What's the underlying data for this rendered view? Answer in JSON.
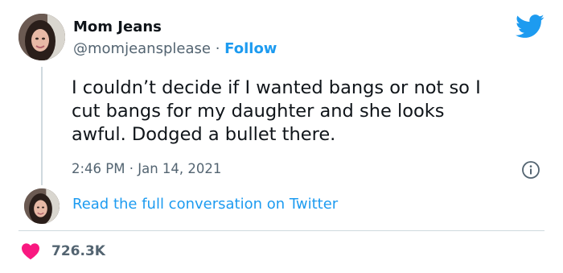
{
  "author": {
    "name": "Mom Jeans",
    "handle": "@momjeansplease",
    "separator": "·",
    "follow_label": "Follow"
  },
  "tweet": {
    "text": "I couldn’t decide if I wanted bangs or not so I\ncut bangs for my daughter and she looks\nawful. Dodged a bullet there.",
    "timestamp": "2:46 PM · Jan 14, 2021"
  },
  "conversation": {
    "link_label": "Read the full conversation on Twitter"
  },
  "engagement": {
    "likes": "726.3K"
  },
  "icons": {
    "brand": "twitter-bird-icon",
    "info": "info-icon",
    "like": "heart-icon"
  },
  "colors": {
    "twitter_blue": "#1d9bf0",
    "like_red": "#f91880",
    "secondary_text": "#536471",
    "primary_text": "#0f1419",
    "divider": "#cfd9de"
  }
}
